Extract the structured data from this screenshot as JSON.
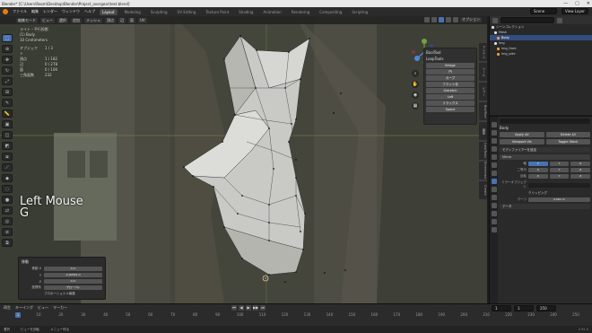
{
  "window": {
    "title": "Blender* [C:\\Users\\Room\\Desktop\\Blender\\Project_overgear\\test.blend]",
    "controls": [
      "—",
      "▢",
      "✕"
    ]
  },
  "menubar": {
    "items": [
      "ファイル",
      "編集",
      "レンダー",
      "ウィンドウ",
      "ヘルプ"
    ],
    "workspaces": [
      "Layout",
      "Modeling",
      "Sculpting",
      "UV Editing",
      "Texture Paint",
      "Shading",
      "Animation",
      "Rendering",
      "Compositing",
      "Scripting"
    ],
    "active_workspace": "Layout",
    "scene": "Scene",
    "view_layer": "View Layer"
  },
  "viewport": {
    "header_buttons": [
      "編集モード",
      "ビュー",
      "選択",
      "追加",
      "メッシュ",
      "頂点",
      "辺",
      "面",
      "UV"
    ],
    "overlay_label": "オプション",
    "stats": {
      "line1": "ライト・平行投影",
      "line2": "(1) Body",
      "line3": "10 Centimeters",
      "rows": [
        {
          "label": "オブジェクト",
          "value": "1 / 3"
        },
        {
          "label": "頂点",
          "value": "1 / 182"
        },
        {
          "label": "辺",
          "value": "0 / 278"
        },
        {
          "label": "面",
          "value": "0 / 100"
        },
        {
          "label": "三角面数",
          "value": "232"
        }
      ]
    },
    "key_hint_line1": "Left Mouse",
    "key_hint_line2": "G",
    "bool_panel": {
      "title": "BoolTool",
      "subtitle": "LoopTools",
      "items": [
        "Bridge",
        "円",
        "カーブ",
        "フラット化",
        "Gstretch",
        "Loft",
        "リラックス",
        "Space"
      ]
    },
    "redo_panel": {
      "title": "移動",
      "rows": [
        {
          "label": "移動 X",
          "value": "0 m"
        },
        {
          "label": "Y",
          "value": "-0.00529 m"
        },
        {
          "label": "Z",
          "value": "0 m"
        },
        {
          "label": "座標系",
          "value": "グローバル"
        }
      ],
      "option": "プロポーショナル編集"
    },
    "side_tabs": [
      "アイテム",
      "ツール",
      "ビュー",
      "BoolTool",
      "編集",
      "LoopTools",
      "Screencast",
      "Create"
    ]
  },
  "outliner": {
    "title": "シーンコレクション",
    "rows": [
      {
        "label": "Mask",
        "type": "coll",
        "selected": false
      },
      {
        "label": "Body",
        "type": "obj",
        "selected": true
      },
      {
        "label": "img",
        "type": "coll",
        "selected": false
      },
      {
        "label": "img_front",
        "type": "obj",
        "selected": false
      },
      {
        "label": "img_side",
        "type": "obj",
        "selected": false
      }
    ]
  },
  "properties": {
    "object_name": "Body",
    "buttons": [
      "Apply All",
      "Delete All",
      "Viewport Vis",
      "Toggle Stack"
    ],
    "add_modifier": "モディファイアーを追加",
    "modifier_name": "Mirror",
    "axis_row": {
      "label": "軸",
      "cells": [
        "X",
        "Y",
        "Z"
      ]
    },
    "section_rows": [
      {
        "label": "二等分",
        "cells": [
          "X",
          "Y",
          "Z"
        ]
      },
      {
        "label": "反転",
        "cells": [
          "X",
          "Y",
          "Z"
        ]
      }
    ],
    "mirror_obj_label": "ミラーオブジェクト",
    "clipping_label": "クリッピング",
    "merge_label": "マージ",
    "merge_value": "0.001 m",
    "sub_section": "データ"
  },
  "timeline": {
    "menus": [
      "再生",
      "キーイング",
      "ビュー",
      "マーカー"
    ],
    "current_frame": "1",
    "start": "1",
    "end": "250",
    "ticks": [
      "0",
      "10",
      "20",
      "30",
      "40",
      "50",
      "60",
      "70",
      "80",
      "90",
      "100",
      "110",
      "120",
      "130",
      "140",
      "150",
      "160",
      "170",
      "180",
      "190",
      "200",
      "210",
      "220",
      "230",
      "240",
      "250"
    ],
    "playback_icons": [
      "⏮",
      "◀",
      "▶",
      "▶▶",
      "⏭"
    ]
  },
  "statusbar": {
    "items": [
      "選択",
      "ビューを回転",
      "メニュー呼出"
    ],
    "version": "2.91.0"
  },
  "colors": {
    "accent": "#4772b3",
    "selected": "#334d80",
    "orange": "#e8a03c"
  }
}
